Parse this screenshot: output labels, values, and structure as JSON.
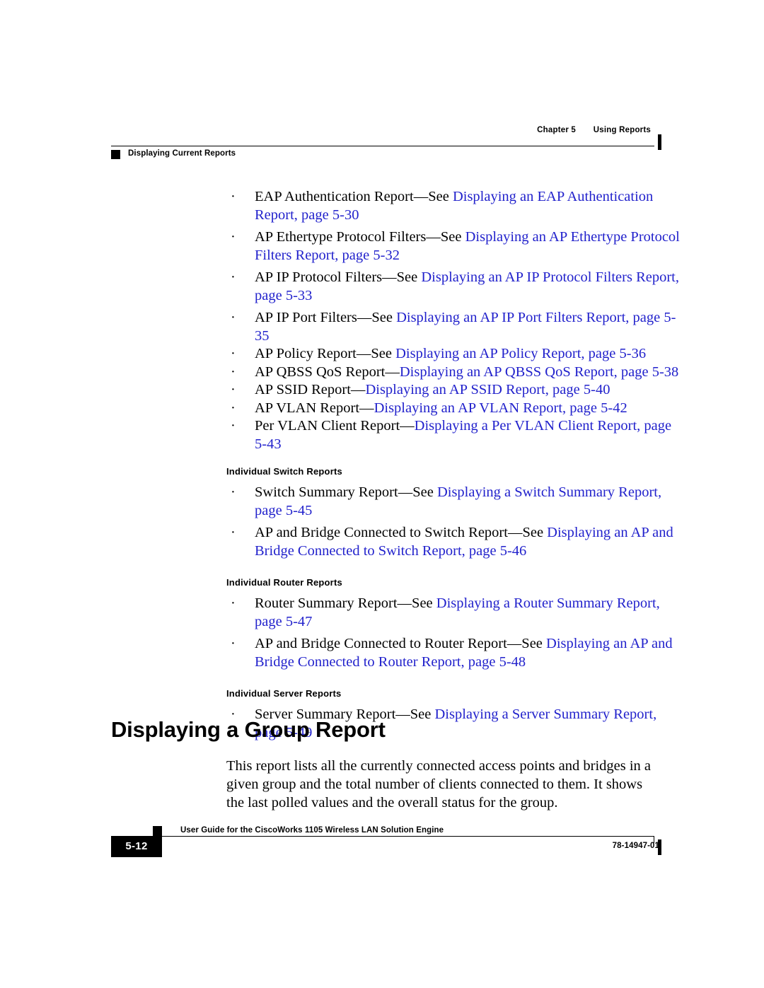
{
  "header": {
    "chapter_label": "Chapter 5",
    "chapter_title": "Using Reports",
    "section_title": "Displaying Current Reports"
  },
  "colors": {
    "link": "#2222CC",
    "text": "#000000",
    "rule": "#000000"
  },
  "content": {
    "bullets_group_1": [
      {
        "plain": "EAP Authentication Report—See ",
        "link": "Displaying an EAP Authentication Report, page 5-30"
      },
      {
        "plain": "AP Ethertype Protocol Filters—See ",
        "link": "Displaying an AP Ethertype Protocol Filters Report, page 5-32"
      },
      {
        "plain": "AP IP Protocol Filters—See ",
        "link": "Displaying an AP IP Protocol Filters Report, page 5-33"
      },
      {
        "plain": "AP IP Port Filters—See ",
        "link": "Displaying an AP IP Port Filters Report, page 5-35"
      },
      {
        "plain": "AP Policy Report—See ",
        "link": "Displaying an AP Policy Report, page 5-36"
      },
      {
        "plain": "AP QBSS QoS Report—",
        "link": "Displaying an AP QBSS QoS Report, page 5-38"
      },
      {
        "plain": "AP SSID Report—",
        "link": "Displaying an AP SSID Report, page 5-40"
      },
      {
        "plain": "AP VLAN Report—",
        "link": "Displaying an AP VLAN Report, page 5-42"
      },
      {
        "plain": "Per VLAN Client Report—",
        "link": "Displaying a Per VLAN Client Report, page 5-43"
      }
    ],
    "switch_heading": "Individual Switch Reports",
    "bullets_switch": [
      {
        "plain": "Switch Summary Report—See ",
        "link": "Displaying a Switch Summary Report, page 5-45"
      },
      {
        "plain": "AP and Bridge Connected to Switch Report—See ",
        "link": "Displaying an AP and Bridge Connected to Switch Report, page 5-46"
      }
    ],
    "router_heading": "Individual Router Reports",
    "bullets_router": [
      {
        "plain": "Router Summary Report—See ",
        "link": "Displaying a Router Summary Report, page 5-47"
      },
      {
        "plain": "AP and Bridge Connected to Router Report—See ",
        "link": "Displaying an AP and Bridge Connected to Router Report, page 5-48"
      }
    ],
    "server_heading": "Individual Server Reports",
    "bullets_server": [
      {
        "plain": "Server Summary Report—See ",
        "link": "Displaying a Server Summary Report, page 5-49"
      }
    ],
    "bullet_glyph": "·"
  },
  "section": {
    "title": "Displaying a Group Report",
    "paragraph": "This report lists all the currently connected access points and bridges in a given group and the total number of clients connected to them. It shows the last polled values and the overall status for the group."
  },
  "footer": {
    "page_number": "5-12",
    "guide_title": "User Guide for the CiscoWorks 1105 Wireless LAN Solution Engine",
    "doc_id": "78-14947-01"
  }
}
